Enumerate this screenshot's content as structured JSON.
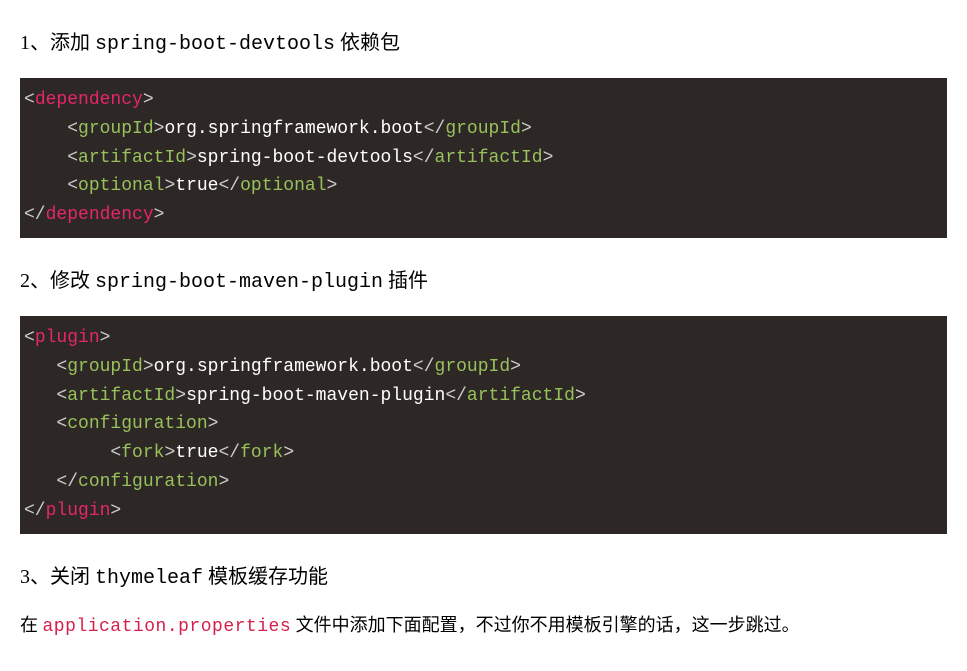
{
  "sections": [
    {
      "heading_prefix": "1、添加 ",
      "heading_mono": "spring-boot-devtools",
      "heading_suffix": " 依赖包"
    },
    {
      "heading_prefix": "2、修改 ",
      "heading_mono": "spring-boot-maven-plugin",
      "heading_suffix": " 插件"
    },
    {
      "heading_prefix": "3、关闭 ",
      "heading_mono": "thymeleaf",
      "heading_suffix": " 模板缓存功能"
    }
  ],
  "code1": {
    "dep_open": "dependency",
    "groupId_tag": "groupId",
    "groupId_val": "org.springframework.boot",
    "artifactId_tag": "artifactId",
    "artifactId_val": "spring-boot-devtools",
    "optional_tag": "optional",
    "optional_val": "true",
    "dep_close": "dependency"
  },
  "code2": {
    "plugin_open": "plugin",
    "groupId_tag": "groupId",
    "groupId_val": "org.springframework.boot",
    "artifactId_tag": "artifactId",
    "artifactId_val": "spring-boot-maven-plugin",
    "config_tag": "configuration",
    "fork_tag": "fork",
    "fork_val": "true",
    "plugin_close": "plugin"
  },
  "para3": {
    "pre": "在 ",
    "code": "application.properties",
    "post": " 文件中添加下面配置，不过你不用模板引擎的话，这一步跳过。"
  },
  "chart_data": null
}
